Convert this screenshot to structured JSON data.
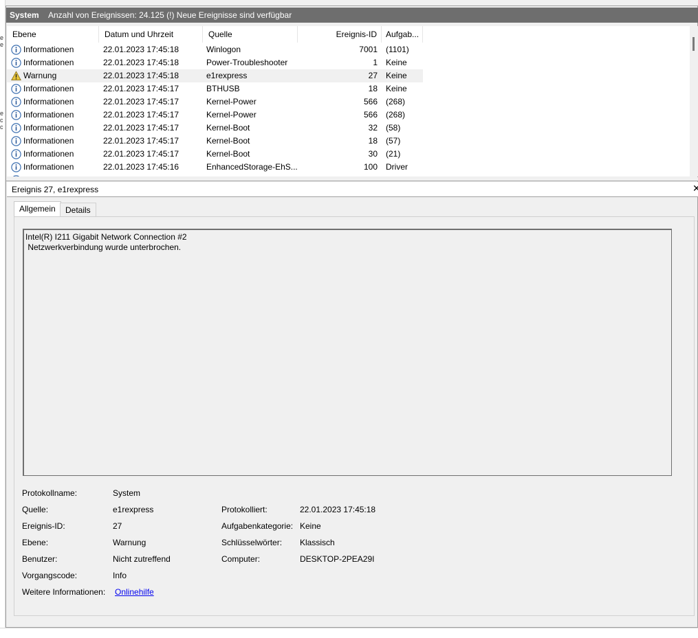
{
  "header": {
    "title": "System",
    "count_text": "Anzahl von Ereignissen: 24.125 (!) Neue Ereignisse sind verfügbar",
    "bg_color": "#6e6e6e"
  },
  "list": {
    "columns": [
      "Ebene",
      "Datum und Uhrzeit",
      "Quelle",
      "Ereignis-ID",
      "Aufgab..."
    ],
    "rows": [
      {
        "icon": "info-icon",
        "level": "Informationen",
        "datetime": "22.01.2023 17:45:18",
        "source": "Winlogon",
        "id": "7001",
        "task": "(1101)"
      },
      {
        "icon": "info-icon",
        "level": "Informationen",
        "datetime": "22.01.2023 17:45:18",
        "source": "Power-Troubleshooter",
        "id": "1",
        "task": "Keine"
      },
      {
        "icon": "warning-icon",
        "level": "Warnung",
        "datetime": "22.01.2023 17:45:18",
        "source": "e1rexpress",
        "id": "27",
        "task": "Keine"
      },
      {
        "icon": "info-icon",
        "level": "Informationen",
        "datetime": "22.01.2023 17:45:17",
        "source": "BTHUSB",
        "id": "18",
        "task": "Keine"
      },
      {
        "icon": "info-icon",
        "level": "Informationen",
        "datetime": "22.01.2023 17:45:17",
        "source": "Kernel-Power",
        "id": "566",
        "task": "(268)"
      },
      {
        "icon": "info-icon",
        "level": "Informationen",
        "datetime": "22.01.2023 17:45:17",
        "source": "Kernel-Power",
        "id": "566",
        "task": "(268)"
      },
      {
        "icon": "info-icon",
        "level": "Informationen",
        "datetime": "22.01.2023 17:45:17",
        "source": "Kernel-Boot",
        "id": "32",
        "task": "(58)"
      },
      {
        "icon": "info-icon",
        "level": "Informationen",
        "datetime": "22.01.2023 17:45:17",
        "source": "Kernel-Boot",
        "id": "18",
        "task": "(57)"
      },
      {
        "icon": "info-icon",
        "level": "Informationen",
        "datetime": "22.01.2023 17:45:17",
        "source": "Kernel-Boot",
        "id": "30",
        "task": "(21)"
      },
      {
        "icon": "info-icon",
        "level": "Informationen",
        "datetime": "22.01.2023 17:45:16",
        "source": "EnhancedStorage-EhS...",
        "id": "100",
        "task": "Driver"
      }
    ],
    "selected_row": 2
  },
  "detail": {
    "title": "Ereignis 27, e1rexpress",
    "close_icon": "close-icon",
    "tabs": [
      "Allgemein",
      "Details"
    ],
    "active_tab": 0,
    "description_lines": [
      "Intel(R) I211 Gigabit Network Connection #2",
      " Netzwerkverbindung wurde unterbrochen."
    ],
    "fields": {
      "protokollname_label": "Protokollname:",
      "protokollname": "System",
      "quelle_label": "Quelle:",
      "quelle": "e1rexpress",
      "ereignis_id_label": "Ereignis-ID:",
      "ereignis_id": "27",
      "ebene_label": "Ebene:",
      "ebene": "Warnung",
      "benutzer_label": "Benutzer:",
      "benutzer": "Nicht zutreffend",
      "vorgangscode_label": "Vorgangscode:",
      "vorgangscode": "Info",
      "weitere_label": "Weitere Informationen:",
      "weitere_link": "Onlinehilfe",
      "protokolliert_label": "Protokolliert:",
      "protokolliert": "22.01.2023 17:45:18",
      "aufgabenkategorie_label": "Aufgabenkategorie:",
      "aufgabenkategorie": "Keine",
      "schluesselwoerter_label": "Schlüsselwörter:",
      "schluesselwoerter": "Klassisch",
      "computer_label": "Computer:",
      "computer": "DESKTOP-2PEA29I"
    }
  }
}
